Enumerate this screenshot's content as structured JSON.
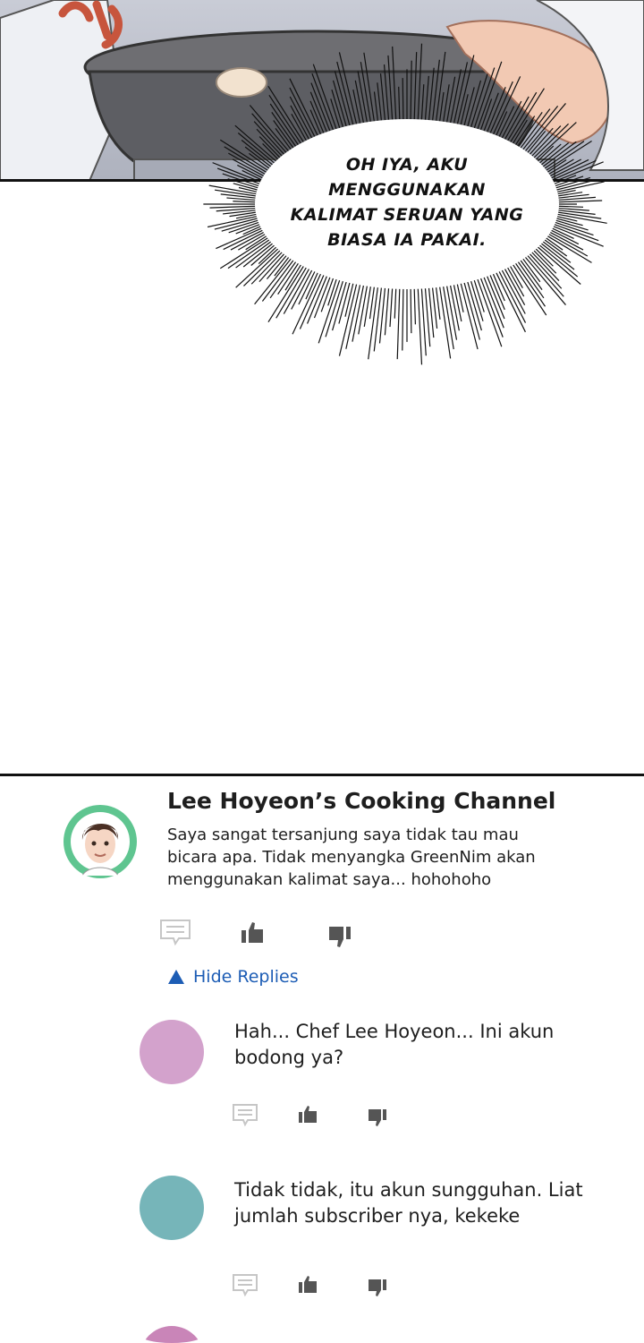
{
  "speech_bubble": {
    "lines": [
      "OH IYA, AKU",
      "MENGGUNAKAN",
      "KALIMAT SERUAN YANG",
      "BIASA IA PAKAI."
    ]
  },
  "top_comment": {
    "author": "Lee Hoyeon’s Cooking Channel",
    "lines": [
      "Saya sangat tersanjung saya tidak tau mau",
      "bicara apa. Tidak menyangka GreenNim akan",
      "menggunakan kalimat saya... hohohoho"
    ],
    "avatar_color": "#5fc590",
    "icons": [
      "reply-icon",
      "thumbs-up-icon",
      "thumbs-down-icon"
    ]
  },
  "hide_replies_label": "Hide Replies",
  "replies": [
    {
      "lines": [
        "Hah... Chef Lee Hoyeon... Ini akun",
        "bodong ya?"
      ],
      "avatar_color": "#d3a2cc"
    },
    {
      "lines": [
        "Tidak tidak, itu akun sungguhan. Liat",
        "jumlah subscriber nya, kekeke"
      ],
      "avatar_color": "#76b5b9"
    }
  ],
  "partial_avatar_color": "#c985b8",
  "accent_color": "#1d5db5"
}
